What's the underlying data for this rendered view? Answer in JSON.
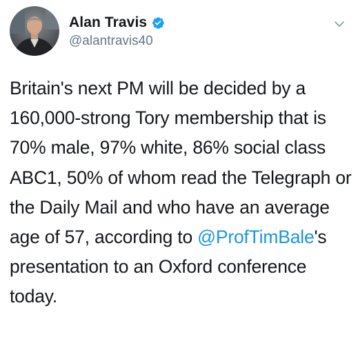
{
  "tweet": {
    "author": {
      "display_name": "Alan Travis",
      "handle": "@alantravis40",
      "verified": true,
      "avatar_icon": "avatar-photo"
    },
    "menu_icon": "chevron-down-icon",
    "text": {
      "part1": "Britain's next PM will be decided by a 160,000-strong Tory membership that is 70% male, 97% white, 86% social class ABC1, 50% of whom read the Telegraph or the Daily Mail and who have an average age of 57, according to ",
      "mention": "@ProfTimBale",
      "part2": "'s presentation to an Oxford conference today."
    },
    "colors": {
      "text": "#14171a",
      "secondary": "#657786",
      "link": "#1b95e0",
      "verified": "#1da1f2"
    }
  }
}
